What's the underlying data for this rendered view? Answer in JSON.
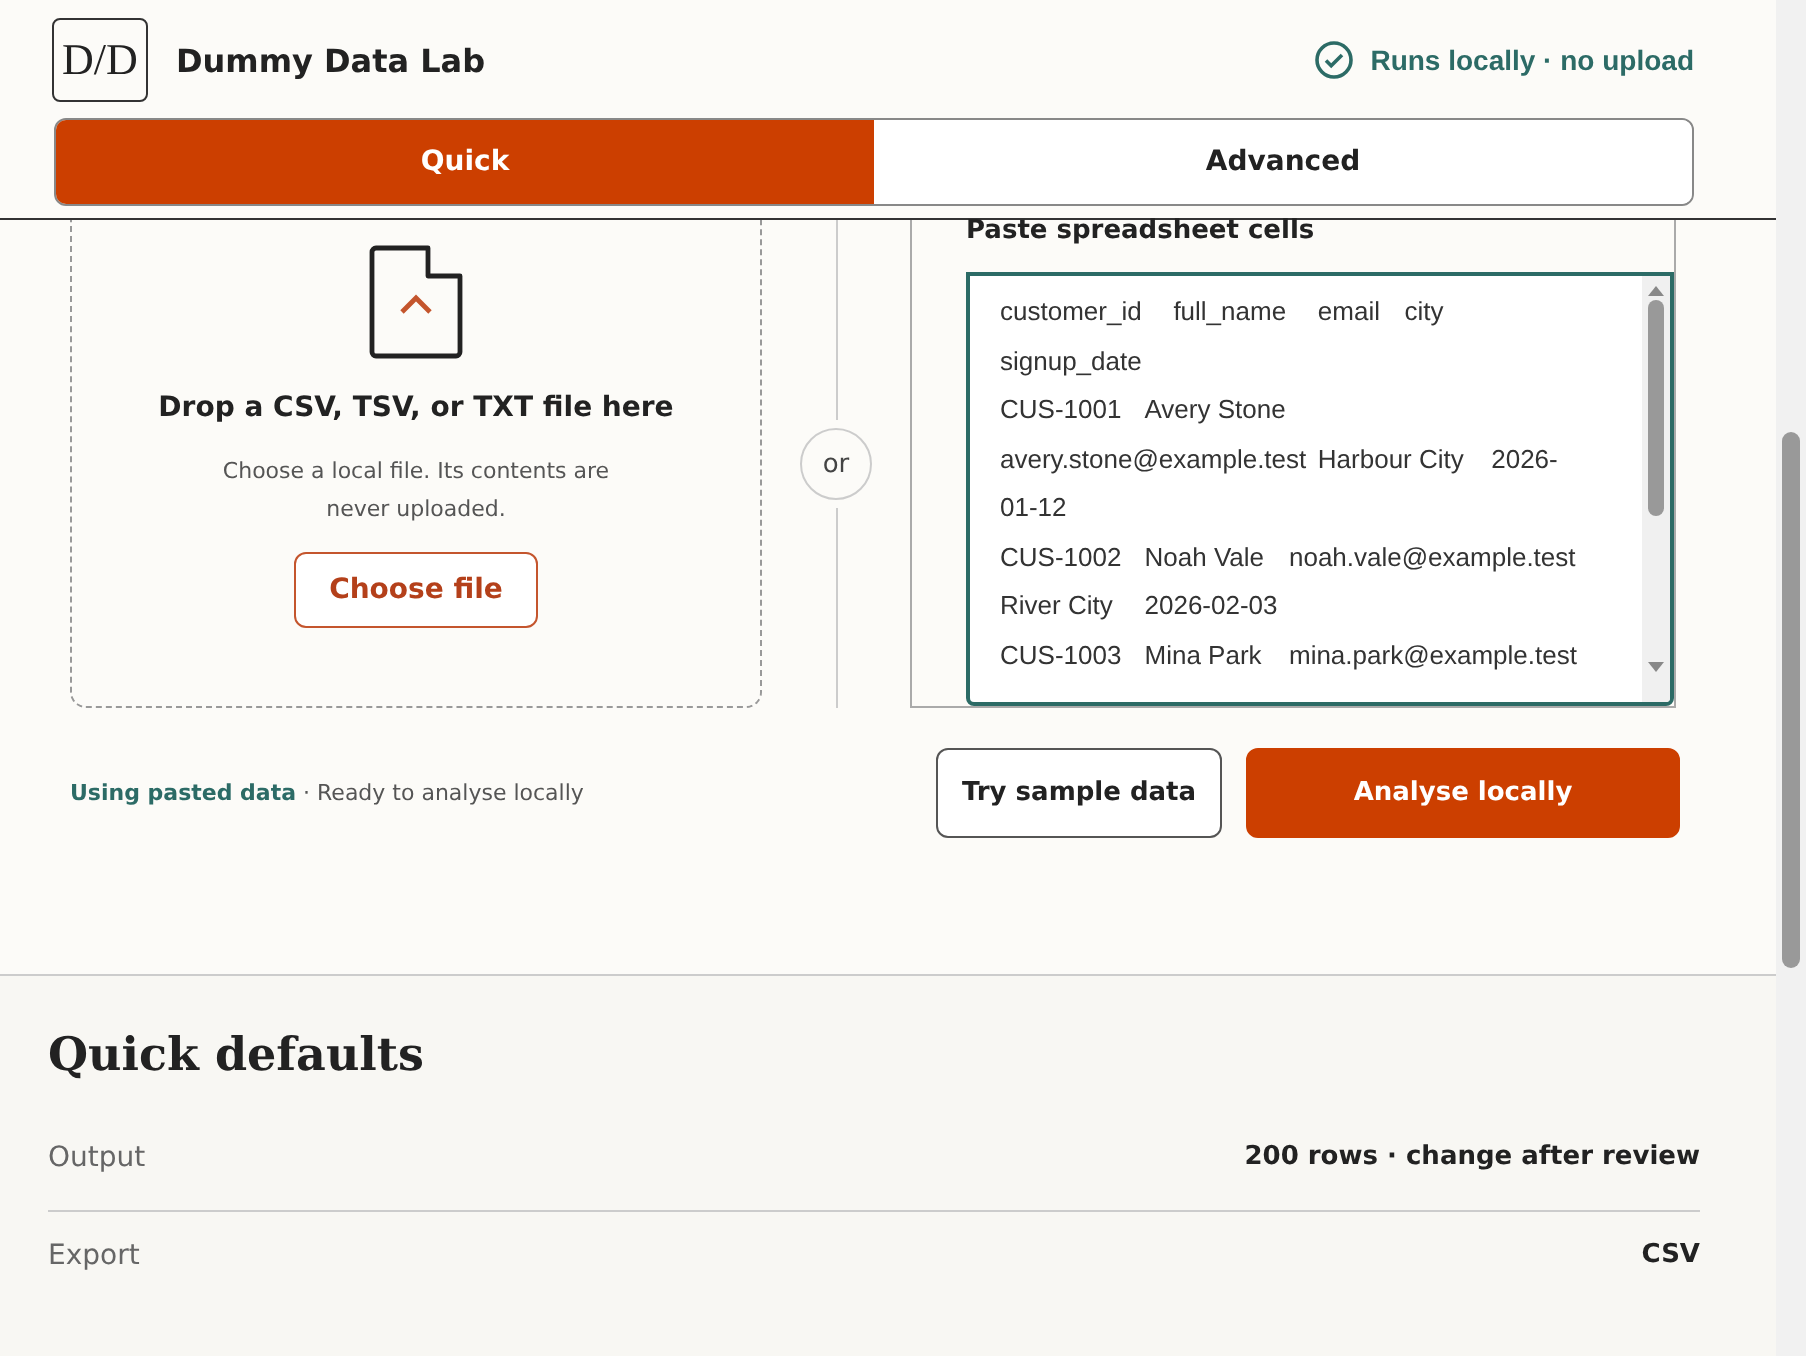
{
  "header": {
    "logo": "D/D",
    "title": "Dummy Data Lab",
    "badge": "Runs locally · no upload"
  },
  "modes": [
    {
      "label": "Quick",
      "selected": true
    },
    {
      "label": "Advanced",
      "selected": false
    }
  ],
  "upload": {
    "title": "Drop a CSV, TSV, or TXT file here",
    "hint": "Choose a local file. Its contents are never uploaded.",
    "button": "Choose file"
  },
  "divider": "or",
  "paste": {
    "label": "Paste spreadsheet cells",
    "lines": [
      "customer_id\tfull_name\temail\tcity",
      "signup_date",
      "CUS-1001\tAvery Stone",
      "avery.stone@example.test\tHarbour City\t2026-",
      "01-12",
      "CUS-1002\tNoah Vale\tnoah.vale@example.test",
      "River City\t2026-02-03",
      "CUS-1003\tMina Park\tmina.park@example.test"
    ]
  },
  "status": {
    "source": "Using pasted data",
    "message": " · Ready to analyse locally"
  },
  "actions": [
    {
      "label": "Try sample data",
      "kind": "secondary"
    },
    {
      "label": "Analyse locally",
      "kind": "primary"
    }
  ],
  "defaults": {
    "title": "Quick defaults",
    "rows": [
      {
        "label": "Output",
        "value": "200 rows · change after review"
      },
      {
        "label": "Export",
        "value": "CSV"
      }
    ]
  }
}
